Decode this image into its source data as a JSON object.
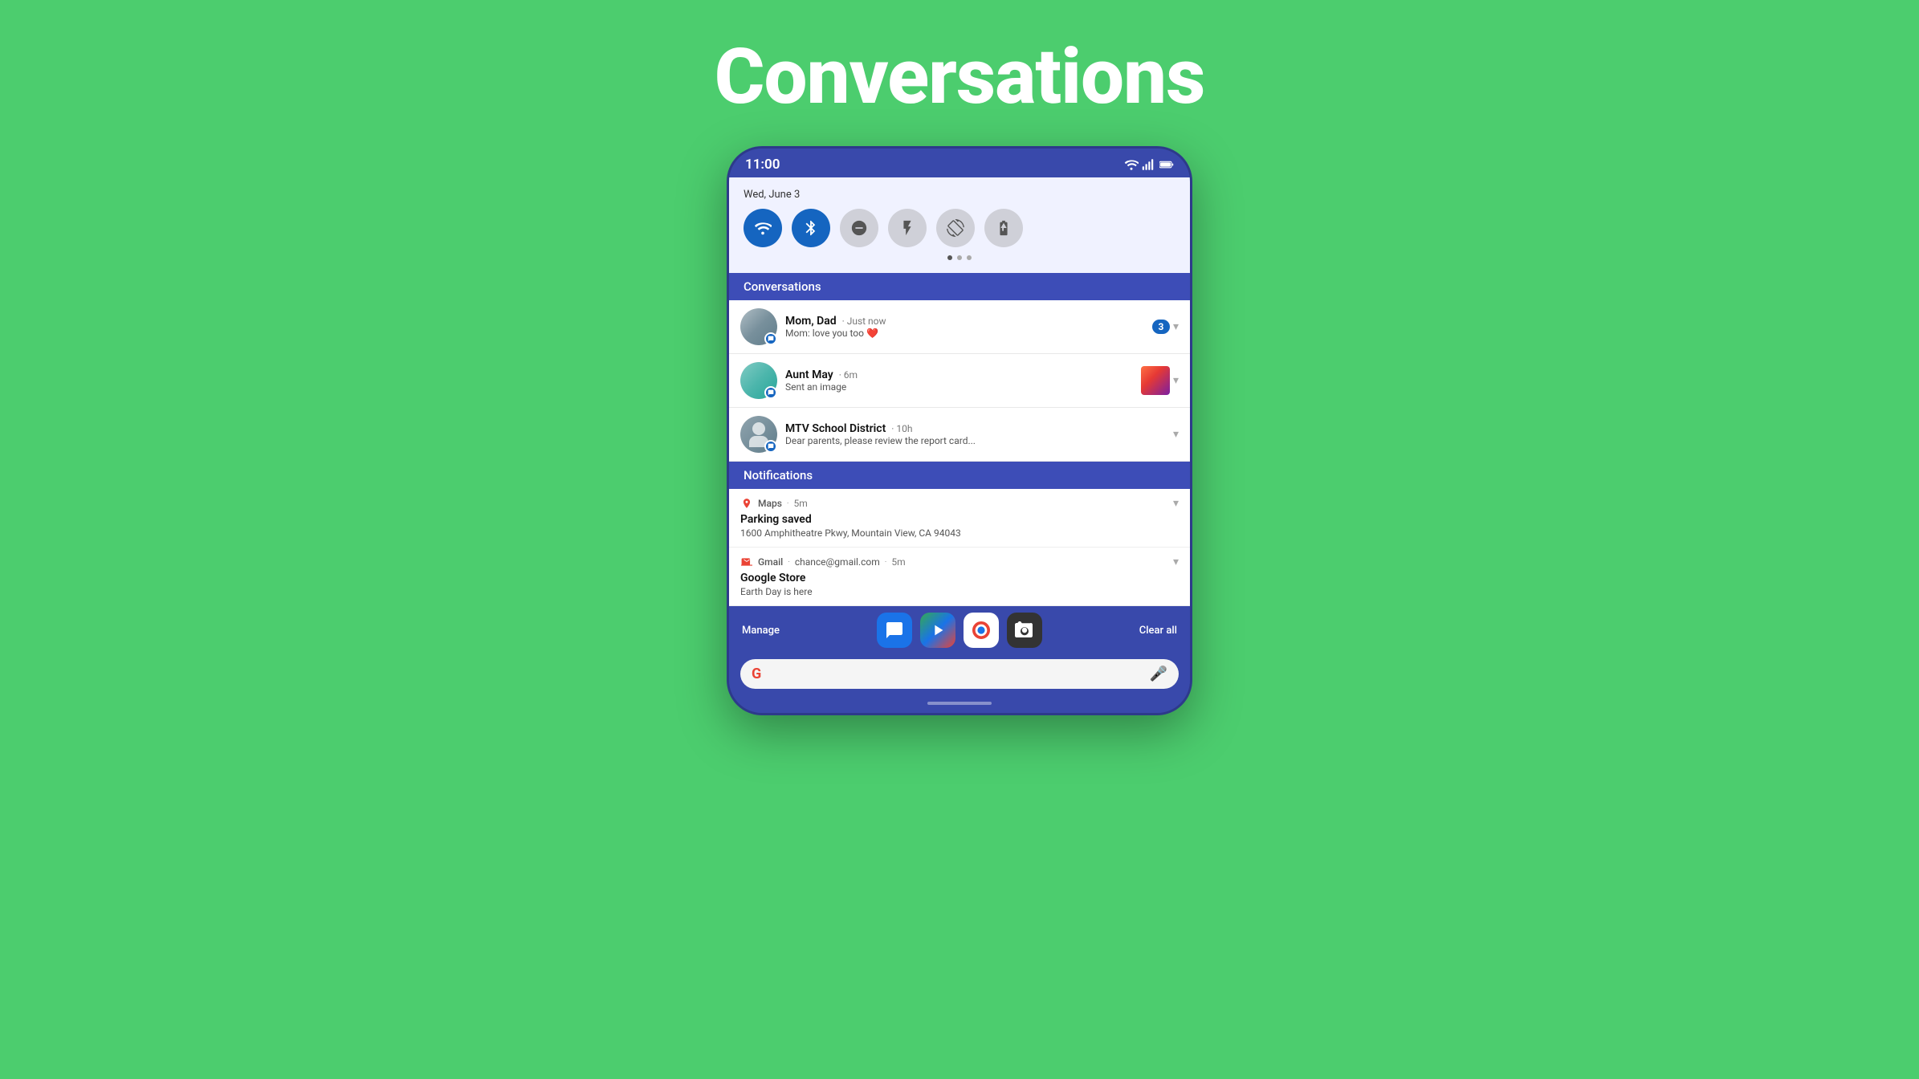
{
  "page": {
    "title": "Conversations",
    "bg_color": "#4ccd6e"
  },
  "phone": {
    "status_bar": {
      "time": "11:00"
    },
    "quick_settings": {
      "date": "Wed, June 3",
      "toggles": [
        {
          "id": "wifi",
          "active": true,
          "icon": "▼"
        },
        {
          "id": "bluetooth",
          "active": true,
          "icon": "✦"
        },
        {
          "id": "dnd",
          "active": false,
          "icon": "⊖"
        },
        {
          "id": "flashlight",
          "active": false,
          "icon": "⚡"
        },
        {
          "id": "autorotate",
          "active": false,
          "icon": "⟳"
        },
        {
          "id": "battery",
          "active": false,
          "icon": "🔋"
        }
      ]
    },
    "conversations_section": {
      "label": "Conversations",
      "items": [
        {
          "name": "Mom, Dad",
          "time": "Just now",
          "message": "Mom: love you too ❤️",
          "badge": "3",
          "has_image": false
        },
        {
          "name": "Aunt May",
          "time": "6m",
          "message": "Sent an image",
          "badge": null,
          "has_image": true
        },
        {
          "name": "MTV School District",
          "time": "10h",
          "message": "Dear parents, please review the report card...",
          "badge": null,
          "has_image": false
        }
      ]
    },
    "notifications_section": {
      "label": "Notifications",
      "items": [
        {
          "app": "Maps",
          "time": "5m",
          "title": "Parking saved",
          "body": "1600 Amphitheatre Pkwy, Mountain View, CA 94043",
          "email": null
        },
        {
          "app": "Gmail",
          "email": "chance@gmail.com",
          "time": "5m",
          "title": "Google Store",
          "body": "Earth Day is here",
          "email_addr": "chance@gmail.com"
        }
      ]
    },
    "dock": {
      "manage_label": "Manage",
      "clear_label": "Clear all",
      "apps": [
        {
          "id": "messages",
          "label": "Messages"
        },
        {
          "id": "play",
          "label": "Play"
        },
        {
          "id": "chrome",
          "label": "Chrome"
        },
        {
          "id": "camera",
          "label": "Camera"
        }
      ]
    },
    "search_bar": {
      "placeholder": ""
    }
  }
}
